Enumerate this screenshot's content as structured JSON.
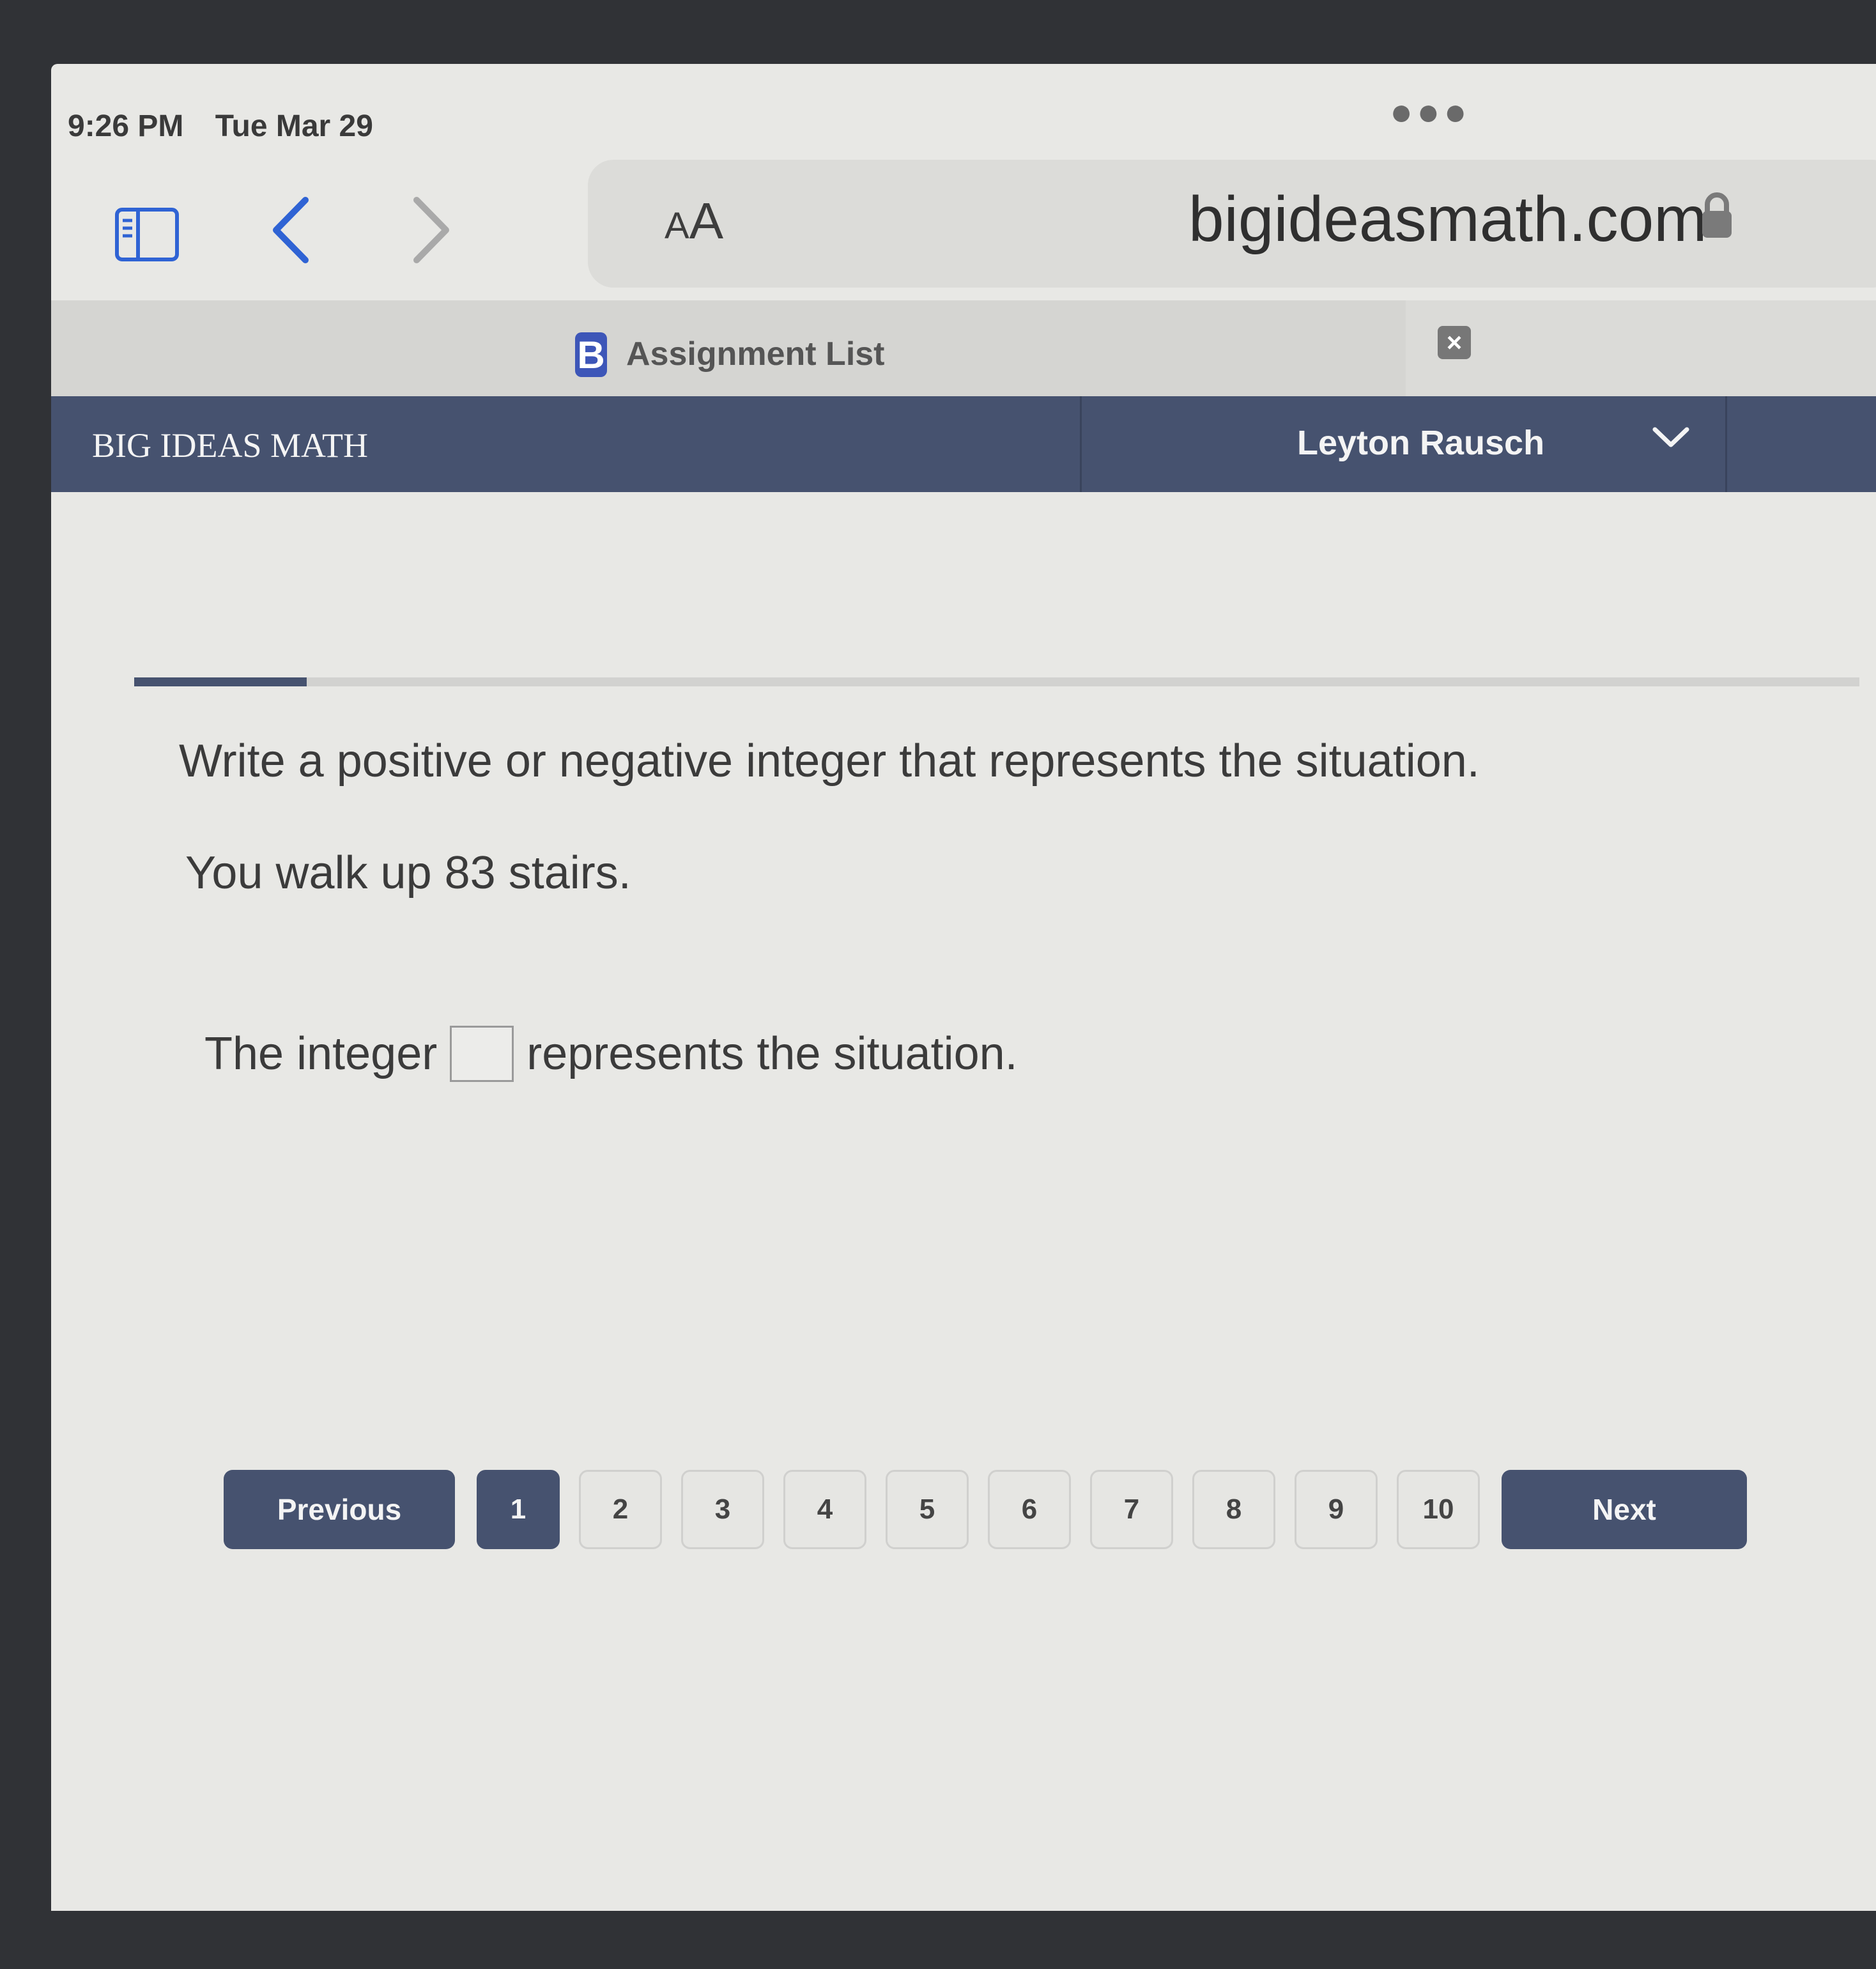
{
  "status_bar": {
    "time": "9:26 PM",
    "date": "Tue Mar 29"
  },
  "browser": {
    "text_size_label_small": "A",
    "text_size_label_large": "A",
    "url": "bigideasmath.com",
    "tab_title": "Assignment List",
    "tab_logo": "B"
  },
  "header": {
    "brand": "BIG IDEAS MATH",
    "user_name": "Leyton Rausch"
  },
  "progress": {
    "fraction": 0.1
  },
  "question": {
    "prompt": "Write a positive or negative integer that represents the situation.",
    "situation": "You walk up 83 stairs.",
    "answer_prefix": "The integer",
    "answer_suffix": "represents the situation.",
    "answer_value": ""
  },
  "pagination": {
    "previous_label": "Previous",
    "next_label": "Next",
    "pages": [
      "1",
      "2",
      "3",
      "4",
      "5",
      "6",
      "7",
      "8",
      "9",
      "10"
    ],
    "current": "1"
  }
}
